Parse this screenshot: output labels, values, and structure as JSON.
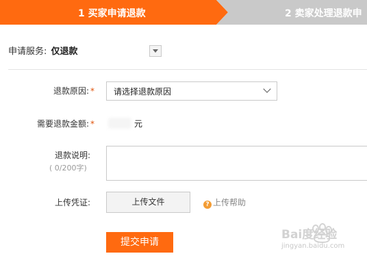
{
  "steps": [
    {
      "label": "1 买家申请退款"
    },
    {
      "label": "2 卖家处理退款申"
    }
  ],
  "service": {
    "label": "申请服务:",
    "value": "仅退款"
  },
  "form": {
    "reason": {
      "label": "退款原因:",
      "required": "*",
      "placeholder": "请选择退款原因"
    },
    "amount": {
      "label": "需要退款金额:",
      "required": "*",
      "unit": "元"
    },
    "description": {
      "label": "退款说明:",
      "counter": "( 0/200字)"
    },
    "proof": {
      "label": "上传凭证:",
      "upload_button": "上传文件",
      "help": "上传帮助",
      "help_icon_glyph": "?"
    }
  },
  "submit_label": "提交申请",
  "watermark": {
    "brand": "Bai度经验",
    "url": "jingyan.baidu.com"
  },
  "colors": {
    "accent": "#ff6a10",
    "step_inactive": "#c9c9c9"
  }
}
